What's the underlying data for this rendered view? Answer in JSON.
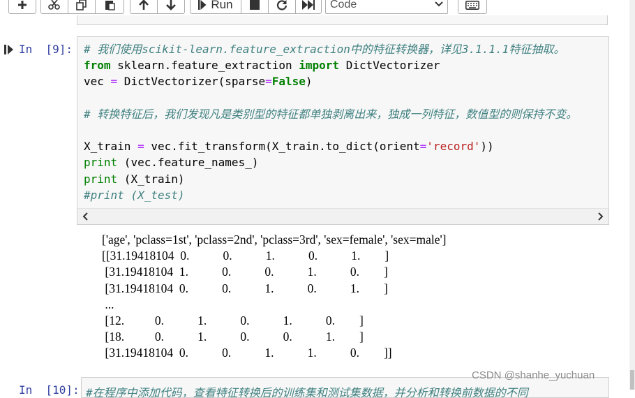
{
  "toolbar": {
    "run_label": "Run",
    "cell_type": "Code",
    "icons": [
      "plus-icon",
      "scissors-icon",
      "copy-icon",
      "paste-icon",
      "arrow-up-icon",
      "arrow-down-icon",
      "run-icon",
      "stop-icon",
      "restart-icon",
      "fast-forward-icon",
      "keyboard-icon"
    ]
  },
  "cell": {
    "prompt": "In  [9]:",
    "code_lines": [
      "# 我们使用scikit-learn.feature_extraction中的特征转换器，详见3.1.1.1特征抽取。",
      "from sklearn.feature_extraction import DictVectorizer",
      "vec = DictVectorizer(sparse=False)",
      "",
      "# 转换特征后，我们发现凡是类别型的特征都单独剥离出来，独成一列特征，数值型的则保持不变。",
      "",
      "X_train = vec.fit_transform(X_train.to_dict(orient='record'))",
      "print (vec.feature_names_)",
      "print (X_train)",
      "#print (X_test)"
    ],
    "output_lines": [
      "['age', 'pclass=1st', 'pclass=2nd', 'pclass=3rd', 'sex=female', 'sex=male']",
      "[[31.19418104  0.           0.           1.           0.           1.        ]",
      " [31.19418104  1.           0.           0.           1.           0.        ]",
      " [31.19418104  0.           0.           1.           0.           1.        ]",
      " ...",
      " [12.          0.           1.           0.           1.           0.        ]",
      " [18.          0.           1.           0.           0.           1.        ]",
      " [31.19418104  0.           0.           1.           1.           0.        ]]"
    ]
  },
  "next_cell": {
    "prompt": "In  [10]:",
    "code_preview": "#在程序中添加代码，查看特征转换后的训练集和测试集数据，并分析和转换前数据的不同"
  },
  "watermark": "CSDN @shanhe_yuchuan",
  "colors": {
    "prompt": "#303f9f",
    "comment": "#408080",
    "keyword": "#008000",
    "string": "#ba2121",
    "operator": "#aa22ff",
    "cell_bg": "#f7f7f7"
  }
}
